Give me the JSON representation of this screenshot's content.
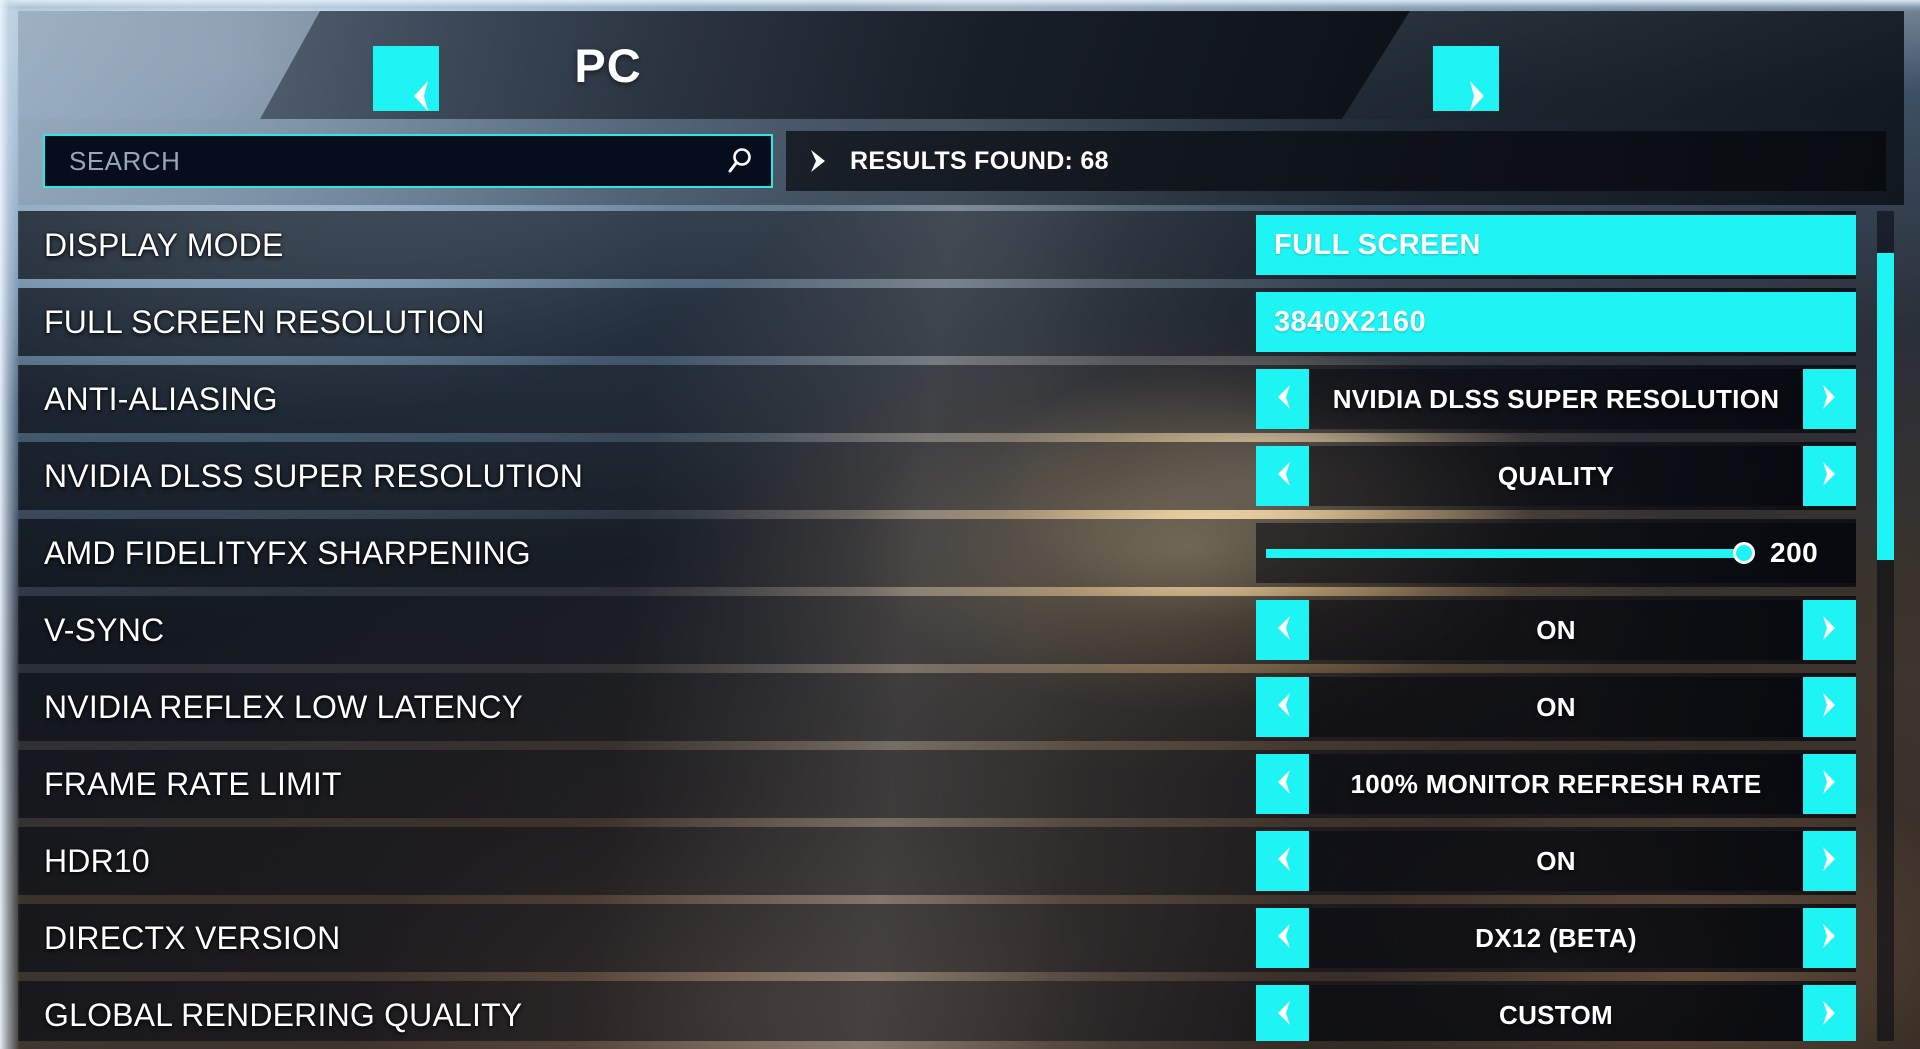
{
  "header": {
    "title": "PC",
    "prev_label": "previous category",
    "next_label": "next category"
  },
  "search": {
    "placeholder": "SEARCH",
    "value": "",
    "icon": "magnifier-icon",
    "results_text": "RESULTS FOUND: 68",
    "results_count": 68,
    "results_icon": "chevron-right-icon"
  },
  "colors": {
    "accent": "#1EF4F4",
    "accent_border": "#2EE6E6",
    "text": "#FFFFFF",
    "placeholder": "#9AA6B4",
    "field_bg": "#060D1D"
  },
  "scrollbar": {
    "thumb_top_pct": 5,
    "thumb_height_pct": 37
  },
  "settings": [
    {
      "label": "DISPLAY MODE",
      "type": "solid",
      "value": "FULL SCREEN"
    },
    {
      "label": "FULL SCREEN RESOLUTION",
      "type": "solid",
      "value": "3840X2160"
    },
    {
      "label": "ANTI-ALIASING",
      "type": "stepper",
      "value": "NVIDIA DLSS SUPER RESOLUTION"
    },
    {
      "label": "NVIDIA DLSS SUPER RESOLUTION",
      "type": "stepper",
      "value": "QUALITY"
    },
    {
      "label": "AMD FIDELITYFX SHARPENING",
      "type": "slider",
      "value": "200",
      "fill_pct": 100
    },
    {
      "label": "V-SYNC",
      "type": "stepper",
      "value": "ON"
    },
    {
      "label": "NVIDIA REFLEX LOW LATENCY",
      "type": "stepper",
      "value": "ON"
    },
    {
      "label": "FRAME RATE LIMIT",
      "type": "stepper",
      "value": "100% MONITOR REFRESH RATE"
    },
    {
      "label": "HDR10",
      "type": "stepper",
      "value": "ON"
    },
    {
      "label": "DIRECTX VERSION",
      "type": "stepper",
      "value": "DX12 (BETA)"
    },
    {
      "label": "GLOBAL RENDERING QUALITY",
      "type": "stepper",
      "value": "CUSTOM"
    }
  ],
  "stepper_controls": {
    "prev_icon": "chevron-left-icon",
    "next_icon": "chevron-right-icon"
  }
}
